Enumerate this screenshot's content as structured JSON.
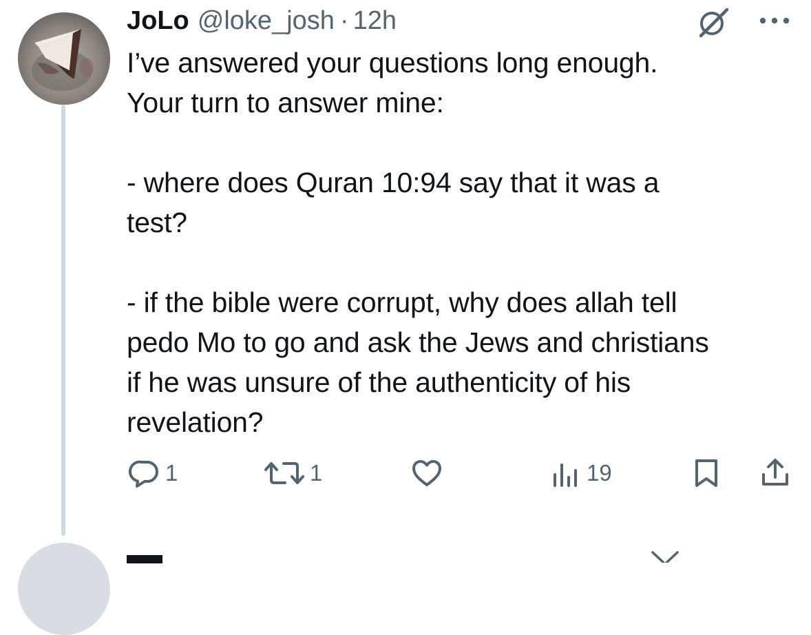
{
  "tweet": {
    "author_name": "JoLo",
    "author_handle": "@loke_josh",
    "separator": "·",
    "timestamp": "12h",
    "body": "I’ve answered your questions long enough.\nYour turn to answer mine:\n\n- where does Quran 10:94 say that it was a\ntest?\n\n- if the bible were corrupt, why does allah tell\npedo Mo to go and ask the Jews and christians\nif he was unsure of the authenticity of his\nrevelation?",
    "actions": {
      "replies": "1",
      "retweets": "1",
      "views": "19"
    }
  },
  "icons": {
    "header": [
      "grok-icon",
      "more-icon"
    ],
    "actions": [
      "reply-icon",
      "retweet-icon",
      "like-icon",
      "views-icon",
      "bookmark-icon",
      "share-icon"
    ]
  },
  "colors": {
    "text": "#0f1419",
    "secondary": "#536471",
    "thread_line": "#cfd9de"
  }
}
